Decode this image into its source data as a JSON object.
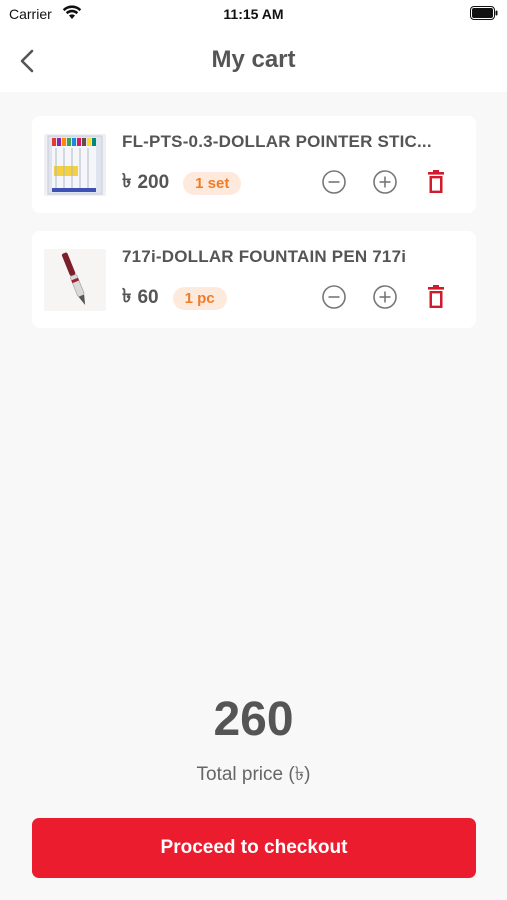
{
  "status_bar": {
    "carrier": "Carrier",
    "time": "11:15 AM"
  },
  "header": {
    "title": "My cart",
    "back_icon": "chevron-left-icon"
  },
  "cart": {
    "items": [
      {
        "name": "FL-PTS-0.3-DOLLAR POINTER STIC...",
        "currency": "৳",
        "price": "200",
        "unit": "1 set"
      },
      {
        "name": "717i-DOLLAR FOUNTAIN PEN 717i",
        "currency": "৳",
        "price": "60",
        "unit": "1 pc"
      }
    ]
  },
  "summary": {
    "total": "260",
    "label": "Total price (৳)"
  },
  "checkout": {
    "label": "Proceed to checkout"
  },
  "colors": {
    "accent": "#ec1c2f",
    "badge_bg": "#fdeadc",
    "badge_text": "#f07c2a",
    "delete": "#d31a2c"
  }
}
